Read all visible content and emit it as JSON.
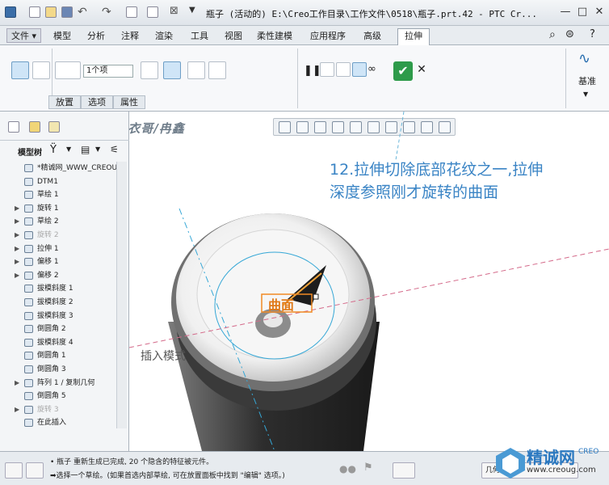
{
  "window": {
    "title": "瓶子 (活动的) E:\\Creo工作目录\\工作文件\\0518\\瓶子.prt.42 - PTC Cr..."
  },
  "tabs": {
    "file": "文件",
    "items": [
      "模型",
      "分析",
      "注释",
      "渲染",
      "工具",
      "视图",
      "柔性建模",
      "应用程序",
      "高级"
    ],
    "active": "拉伸"
  },
  "ribbon": {
    "depth_value": "1个项",
    "subtabs": [
      "放置",
      "选项",
      "属性"
    ],
    "datum_label": "基准"
  },
  "left_panel": {
    "model_tree_label": "模型树",
    "items": [
      {
        "label": "*精诚网_WWW_CREOU",
        "dim": false,
        "expand": false
      },
      {
        "label": "DTM1",
        "dim": false,
        "expand": false
      },
      {
        "label": "草绘 1",
        "dim": false,
        "expand": false
      },
      {
        "label": "旋转 1",
        "dim": false,
        "expand": true
      },
      {
        "label": "草绘 2",
        "dim": false,
        "expand": true
      },
      {
        "label": "旋转 2",
        "dim": true,
        "expand": true
      },
      {
        "label": "拉伸 1",
        "dim": false,
        "expand": true
      },
      {
        "label": "偏移 1",
        "dim": false,
        "expand": true
      },
      {
        "label": "偏移 2",
        "dim": false,
        "expand": true
      },
      {
        "label": "拔模斜度 1",
        "dim": false,
        "expand": false
      },
      {
        "label": "拔模斜度 2",
        "dim": false,
        "expand": false
      },
      {
        "label": "拔模斜度 3",
        "dim": false,
        "expand": false
      },
      {
        "label": "倒圆角 2",
        "dim": false,
        "expand": false
      },
      {
        "label": "拔模斜度 4",
        "dim": false,
        "expand": false
      },
      {
        "label": "倒圆角 1",
        "dim": false,
        "expand": false
      },
      {
        "label": "倒圆角 3",
        "dim": false,
        "expand": false
      },
      {
        "label": "阵列 1 / 复制几何",
        "dim": false,
        "expand": true
      },
      {
        "label": "倒圆角 5",
        "dim": false,
        "expand": false
      },
      {
        "label": "旋转 3",
        "dim": true,
        "expand": true
      },
      {
        "label": "在此插入",
        "dim": false,
        "expand": false
      }
    ]
  },
  "viewport": {
    "watermark": "精诚网 破衣哥/冉鑫",
    "note_line1": "12.拉伸切除底部花纹之一,拉伸",
    "note_line2": "深度参照刚才旋转的曲面",
    "insert_mode": "插入模式",
    "surface_label": "曲面"
  },
  "status": {
    "line1": "• 瓶子 重新生成已完成, 20 个隐含的特征被元件。",
    "line2": "➡选择一个草绘。(如果首选内部草绘, 可在放置面板中找到 \"编辑\" 选项。)",
    "geometry_label": "几何"
  },
  "logo": {
    "brand": "精诚网",
    "url": "www.creoug.com",
    "tag": "CREO"
  }
}
